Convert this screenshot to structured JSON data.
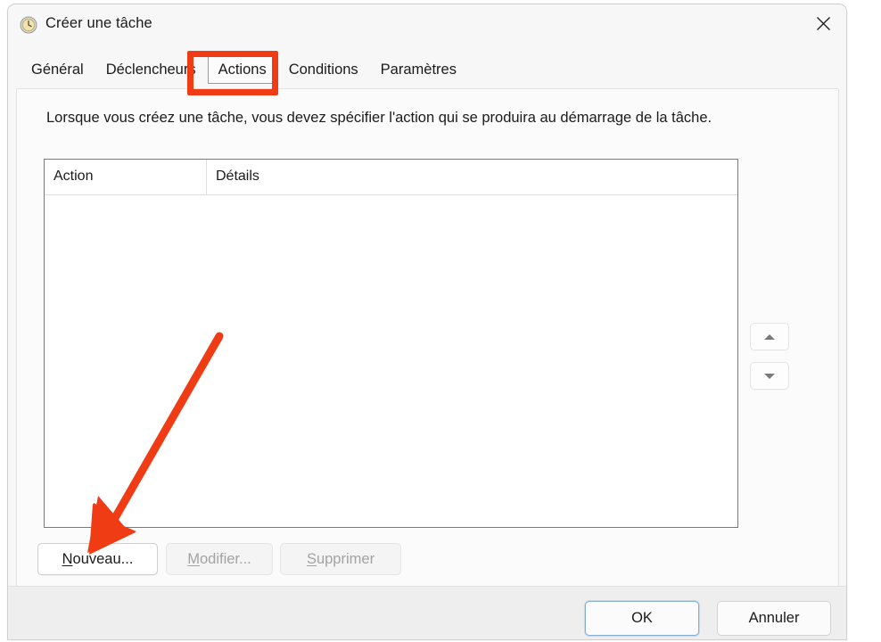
{
  "window": {
    "title": "Créer une tâche",
    "icon": "clock-icon",
    "close_label": "✕"
  },
  "tabs": [
    {
      "label": "Général",
      "selected": false
    },
    {
      "label": "Déclencheurs",
      "selected": false
    },
    {
      "label": "Actions",
      "selected": true
    },
    {
      "label": "Conditions",
      "selected": false
    },
    {
      "label": "Paramètres",
      "selected": false
    }
  ],
  "panel": {
    "description": "Lorsque vous créez une tâche, vous devez spécifier l'action qui se produira au démarrage de la tâche."
  },
  "list": {
    "columns": [
      "Action",
      "Détails"
    ],
    "rows": []
  },
  "move_buttons": {
    "up": "▲",
    "down": "▼"
  },
  "action_buttons": [
    {
      "accesskey": "N",
      "rest": "ouveau...",
      "enabled": true
    },
    {
      "accesskey": "M",
      "rest": "odifier...",
      "enabled": false
    },
    {
      "accesskey": "S",
      "rest": "upprimer",
      "enabled": false
    }
  ],
  "footer": {
    "ok": "OK",
    "cancel": "Annuler"
  },
  "annotations": {
    "highlight_target": "Actions",
    "arrow_target": "Nouveau...",
    "color": "#f03c14"
  }
}
